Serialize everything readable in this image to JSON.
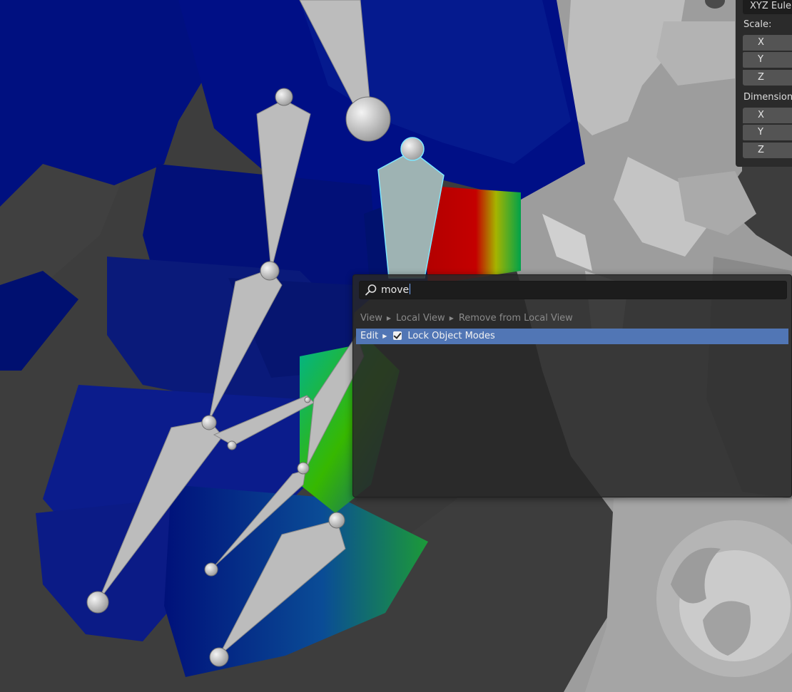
{
  "sidebar": {
    "rotation_mode": "XYZ Euler",
    "scale_label": "Scale:",
    "scale_axes": [
      "X",
      "Y",
      "Z"
    ],
    "dimensions_label": "Dimensions:",
    "dimension_axes": [
      "X",
      "Y",
      "Z"
    ]
  },
  "search": {
    "query": "move",
    "results": [
      {
        "path": [
          "View",
          "Local View"
        ],
        "label": "Remove from Local View",
        "state": "dimmed"
      },
      {
        "path": [
          "Edit"
        ],
        "label": "Lock Object Modes",
        "state": "highlighted",
        "checkbox": true
      }
    ]
  },
  "icons": {
    "search": "search-icon",
    "gizmo": "navigation-gizmo-icon",
    "checkbox": "checkbox-checked-icon",
    "breadcrumb_arrow": "caret-right-icon"
  },
  "colors": {
    "viewport_bg": "#3d3d3d",
    "highlight": "#5176b5",
    "mesh_blue": "#061478",
    "bone": "#c8c8c8",
    "selected_bone_outline": "#7ee8ff"
  }
}
